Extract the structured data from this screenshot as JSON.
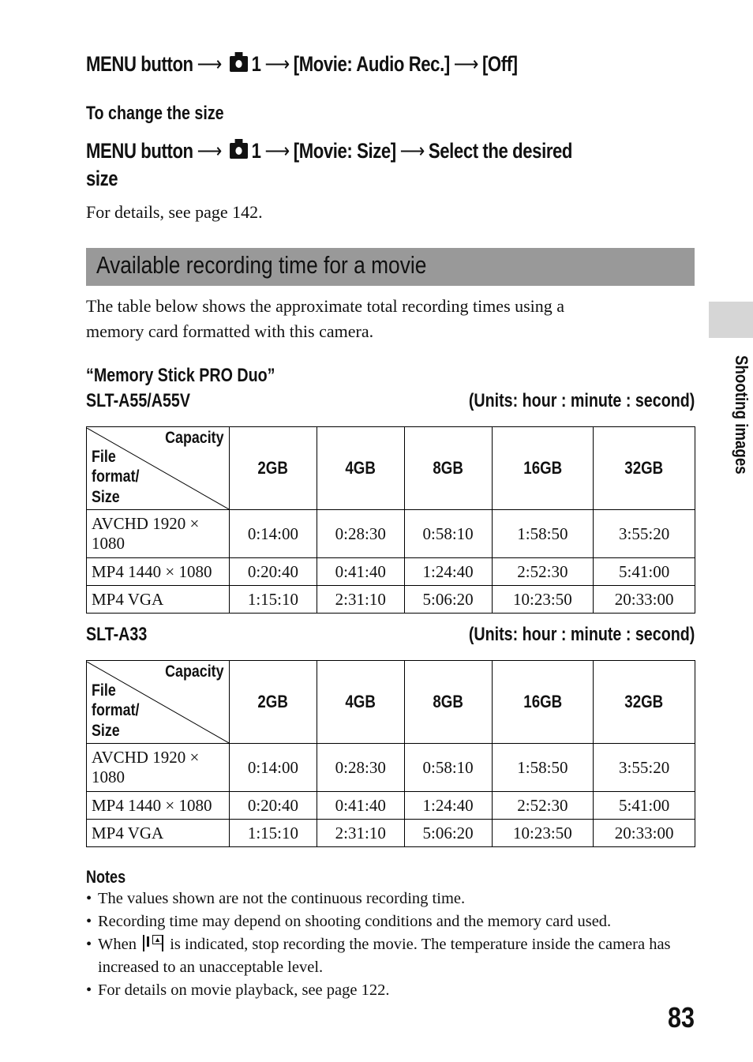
{
  "instructions": {
    "audio_off": {
      "prefix": "MENU button",
      "step1": "1",
      "step2": "[Movie: Audio Rec.]",
      "step3": "[Off]"
    },
    "change_size_heading": "To change the size",
    "size": {
      "prefix": "MENU button",
      "step1": "1",
      "step2": "[Movie: Size]",
      "step3": "Select the desired",
      "step3_cont": "size"
    },
    "details_text": "For details, see page 142."
  },
  "section": {
    "title": "Available recording time for a movie",
    "intro_line1": "The table below shows the approximate total recording times using a",
    "intro_line2": "memory card formatted with this camera."
  },
  "side_tab": {
    "label": "Shooting images"
  },
  "media_label": "“Memory Stick PRO Duo”",
  "tables": [
    {
      "model": "SLT-A55/A55V",
      "units": "(Units: hour : minute : second)",
      "corner_capacity": "Capacity",
      "corner_format": "File\nformat/\nSize",
      "columns": [
        "2GB",
        "4GB",
        "8GB",
        "16GB",
        "32GB"
      ],
      "rows": [
        {
          "format": "AVCHD 1920 × 1080",
          "values": [
            "0:14:00",
            "0:28:30",
            "0:58:10",
            "1:58:50",
            "3:55:20"
          ]
        },
        {
          "format": "MP4 1440 × 1080",
          "values": [
            "0:20:40",
            "0:41:40",
            "1:24:40",
            "2:52:30",
            "5:41:00"
          ]
        },
        {
          "format": "MP4 VGA",
          "values": [
            "1:15:10",
            "2:31:10",
            "5:06:20",
            "10:23:50",
            "20:33:00"
          ]
        }
      ]
    },
    {
      "model": "SLT-A33",
      "units": "(Units: hour : minute : second)",
      "corner_capacity": "Capacity",
      "corner_format": "File\nformat/\nSize",
      "columns": [
        "2GB",
        "4GB",
        "8GB",
        "16GB",
        "32GB"
      ],
      "rows": [
        {
          "format": "AVCHD 1920 × 1080",
          "values": [
            "0:14:00",
            "0:28:30",
            "0:58:10",
            "1:58:50",
            "3:55:20"
          ]
        },
        {
          "format": "MP4 1440 × 1080",
          "values": [
            "0:20:40",
            "0:41:40",
            "1:24:40",
            "2:52:30",
            "5:41:00"
          ]
        },
        {
          "format": "MP4 VGA",
          "values": [
            "1:15:10",
            "2:31:10",
            "5:06:20",
            "10:23:50",
            "20:33:00"
          ]
        }
      ]
    }
  ],
  "notes": {
    "heading": "Notes",
    "items": [
      "The values shown are not the continuous recording time.",
      "Recording time may depend on shooting conditions and the memory card used.",
      {
        "before_icon": "When ",
        "icon": "temperature-warning-icon",
        "after_icon": " is indicated, stop recording the movie. The temperature inside the camera has increased to an unacceptable level."
      },
      "For details on movie playback, see page 122."
    ]
  },
  "page_number": "83"
}
